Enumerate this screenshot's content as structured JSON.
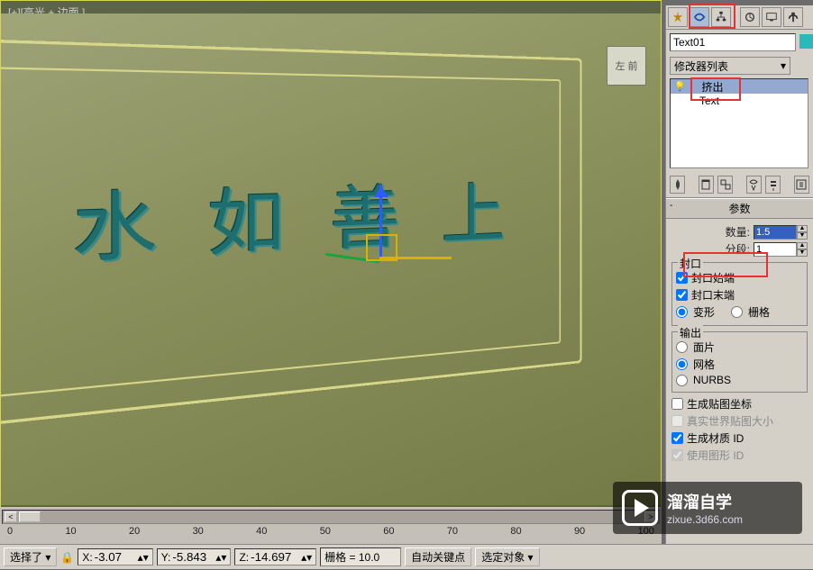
{
  "viewport": {
    "label": "[+][高光 + 边面 ]",
    "viewcube": "左 前",
    "text_chars": [
      "水",
      "如",
      "善",
      "上"
    ]
  },
  "panel": {
    "object_name": "Text01",
    "modifier_list_label": "修改器列表",
    "stack": {
      "item_sel": "挤出",
      "item2": "Text"
    }
  },
  "rollout": {
    "title": "参数",
    "amount_label": "数量:",
    "amount_value": "1.5",
    "segments_label": "分段:",
    "segments_value": "1",
    "cap_group": "封口",
    "cap_start": "封口始端",
    "cap_end": "封口末端",
    "morph": "变形",
    "grid": "栅格",
    "output_group": "输出",
    "out_patch": "面片",
    "out_mesh": "网格",
    "out_nurbs": "NURBS",
    "gen_map": "生成贴图坐标",
    "real_world": "真实世界贴图大小",
    "gen_mat": "生成材质 ID",
    "use_shape": "使用图形 ID"
  },
  "timeline": {
    "ticks": [
      "0",
      "10",
      "20",
      "30",
      "40",
      "50",
      "60",
      "70",
      "80",
      "90",
      "100"
    ]
  },
  "status": {
    "select_label": "选择了",
    "x_label": "X:",
    "x_val": "-3.07",
    "y_label": "Y:",
    "y_val": "-5.843",
    "z_label": "Z:",
    "z_val": "-14.697",
    "grid_label": "栅格 = 10.0",
    "autokey": "自动关键点",
    "selected": "选定对象"
  },
  "watermark": {
    "line1": "溜溜自学",
    "line2": "zixue.3d66.com"
  }
}
